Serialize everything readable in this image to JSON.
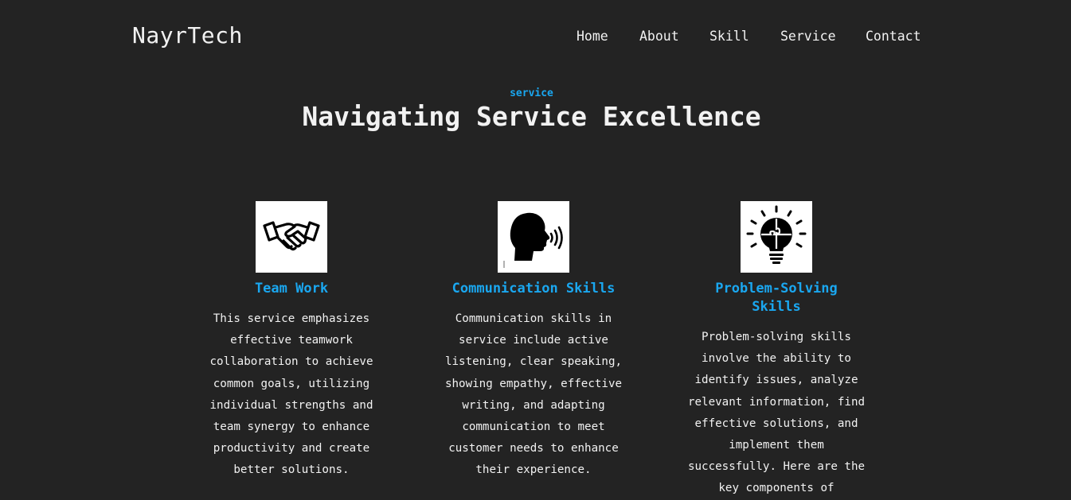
{
  "header": {
    "brand": "NayrTech",
    "menu": [
      "Home",
      "About",
      "Skill",
      "Service",
      "Contact"
    ]
  },
  "section": {
    "eyebrow": "service",
    "title": "Navigating Service Excellence"
  },
  "cards": [
    {
      "icon": "handshake-icon",
      "title": "Team Work",
      "text": "This service emphasizes effective teamwork collaboration to achieve common goals, utilizing individual strengths and team synergy to enhance productivity and create better solutions."
    },
    {
      "icon": "speaking-head-icon",
      "title": "Communication Skills",
      "text": "Communication skills in service include active listening, clear speaking, showing empathy, effective writing, and adapting communication to meet customer needs to enhance their experience."
    },
    {
      "icon": "lightbulb-puzzle-icon",
      "title": "Problem-Solving Skills",
      "text": "Problem-solving skills involve the ability to identify issues, analyze relevant information, find effective solutions, and implement them successfully. Here are the key components of"
    }
  ],
  "colors": {
    "background": "#232323",
    "accent": "#1aa7f0",
    "text": "#f2f2f2"
  }
}
